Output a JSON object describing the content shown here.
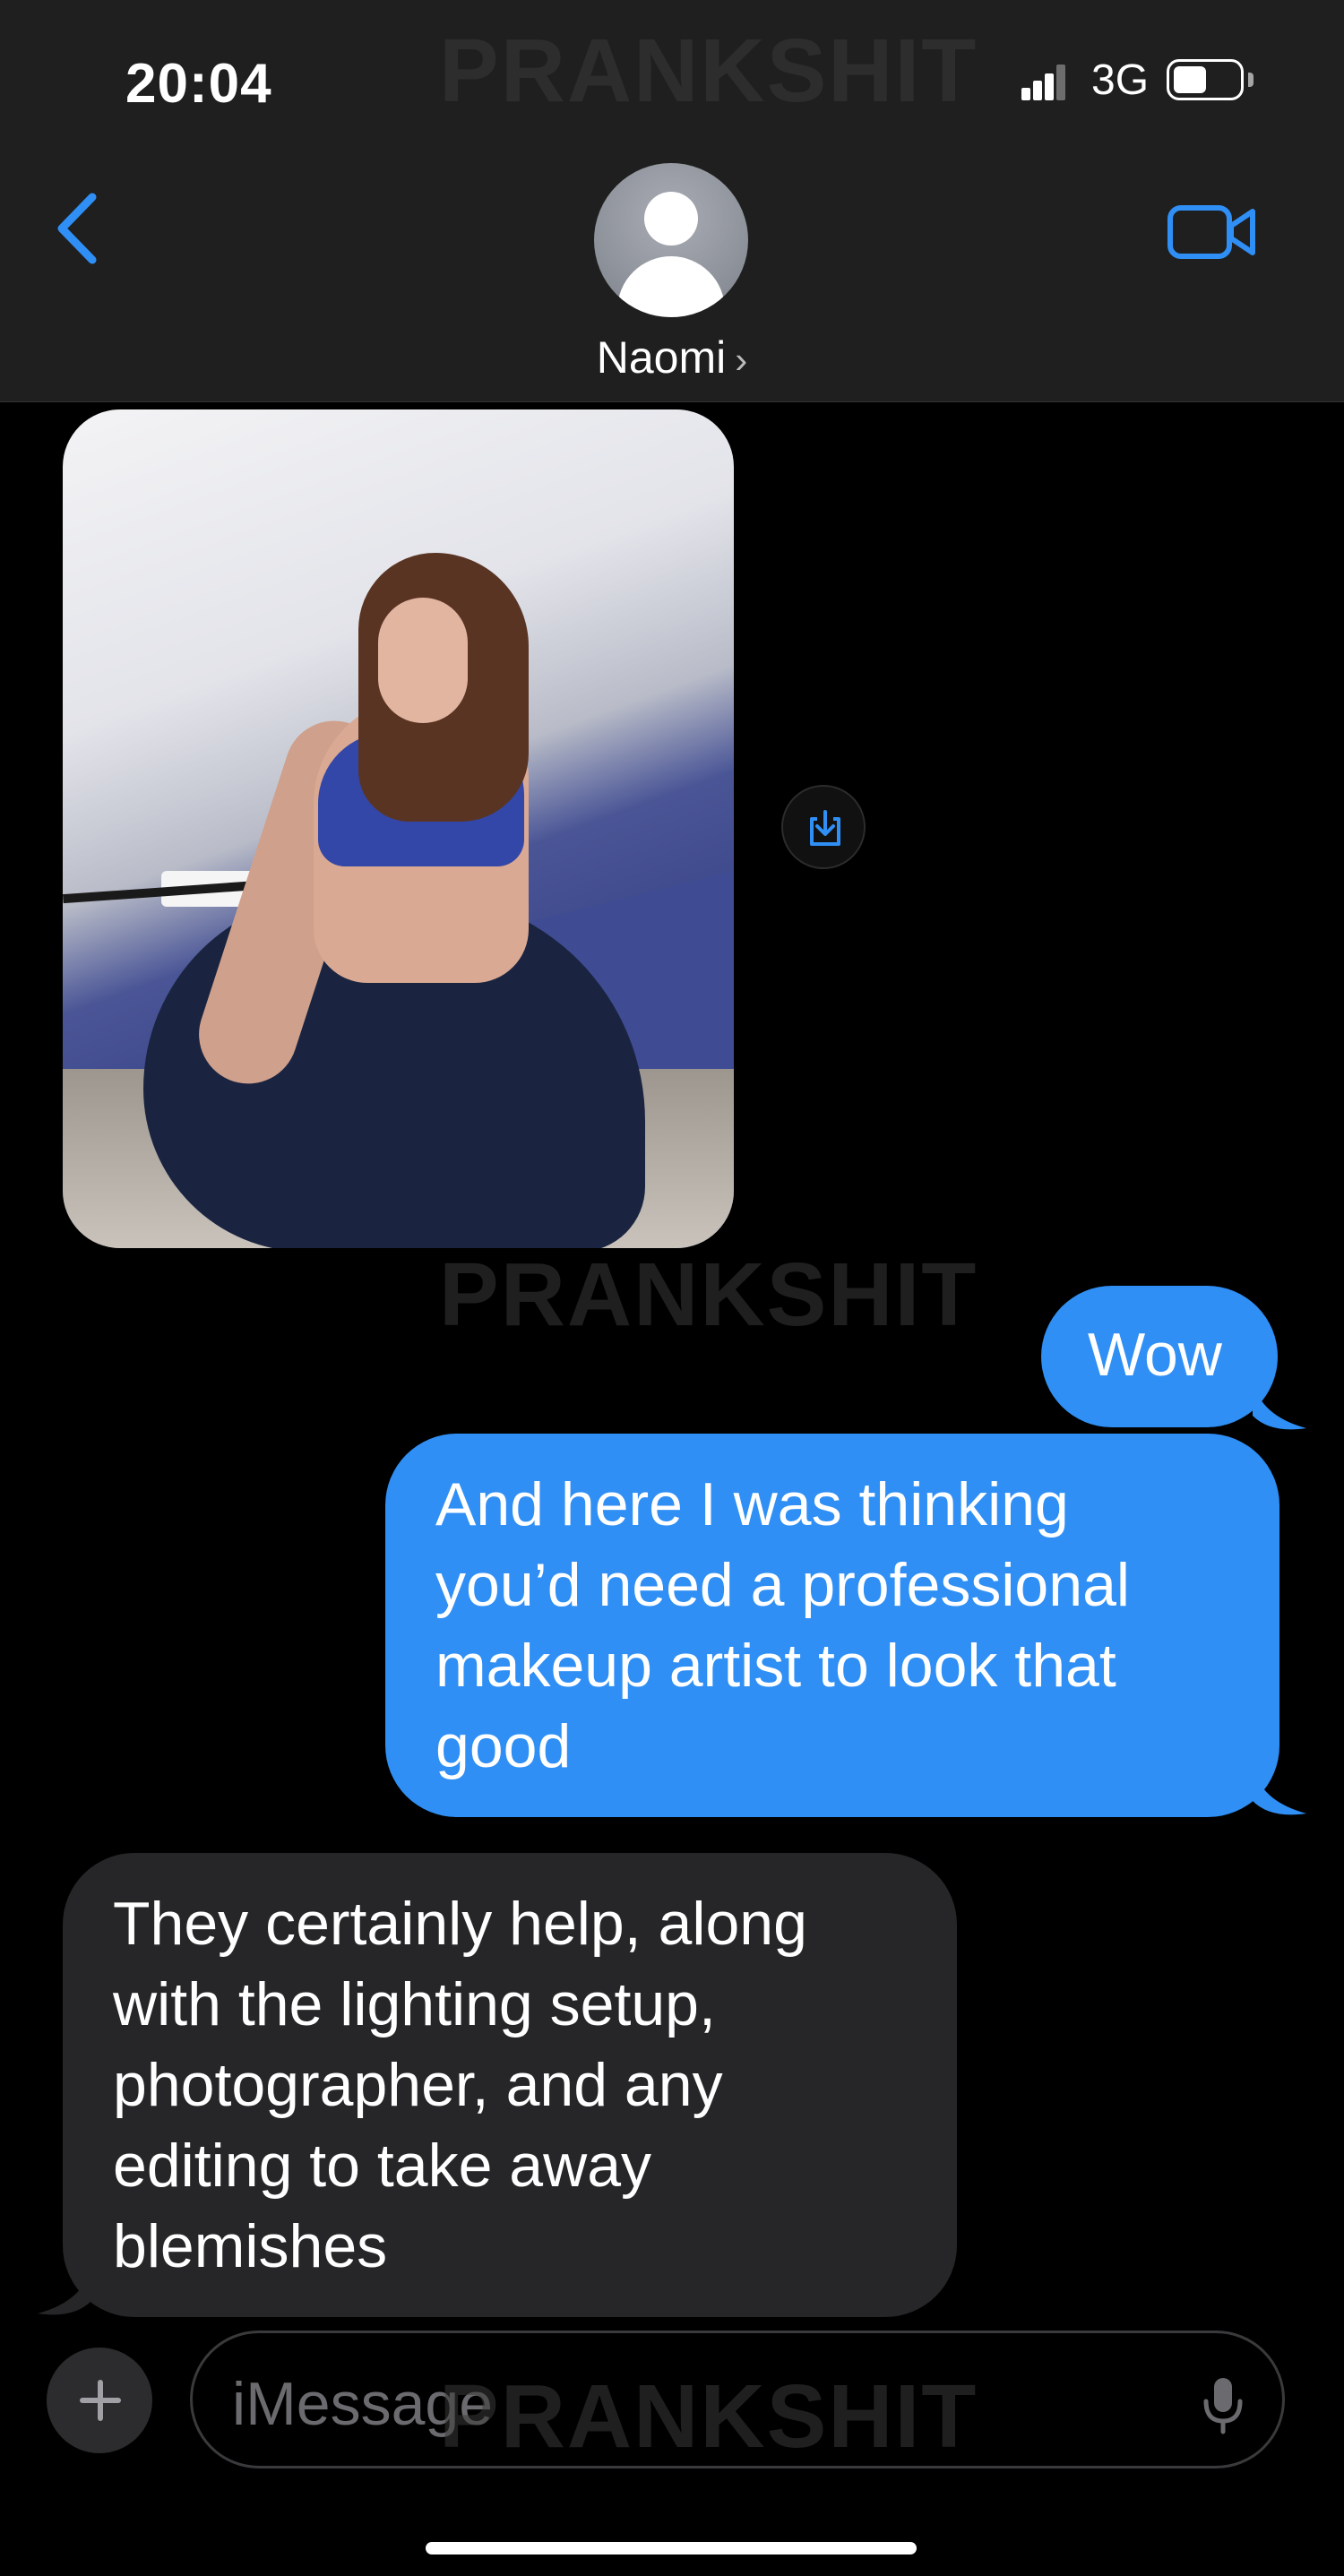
{
  "status_bar": {
    "time": "20:04",
    "network": "3G"
  },
  "header": {
    "contact_name": "Naomi",
    "chevron": "›"
  },
  "watermark": "PRANKSHIT",
  "messages": [
    {
      "direction": "received",
      "type": "image"
    },
    {
      "direction": "sent",
      "text": "Wow"
    },
    {
      "direction": "sent",
      "text": "And here I was thinking\nyou’d need a professional\nmakeup artist to look that\ngood"
    },
    {
      "direction": "received",
      "text": "They certainly help, along\nwith the lighting setup,\nphotographer, and any\nediting to take away\nblemishes"
    }
  ],
  "composer": {
    "placeholder": "iMessage"
  },
  "icons": {
    "back": "chevron-left-icon",
    "video": "video-camera-icon",
    "save": "download-icon",
    "add": "plus-icon",
    "mic": "microphone-icon"
  },
  "colors": {
    "accent": "#2f8ff5",
    "sent_bubble": "#2f8ff5",
    "received_bubble": "#262628",
    "background": "#000000"
  }
}
